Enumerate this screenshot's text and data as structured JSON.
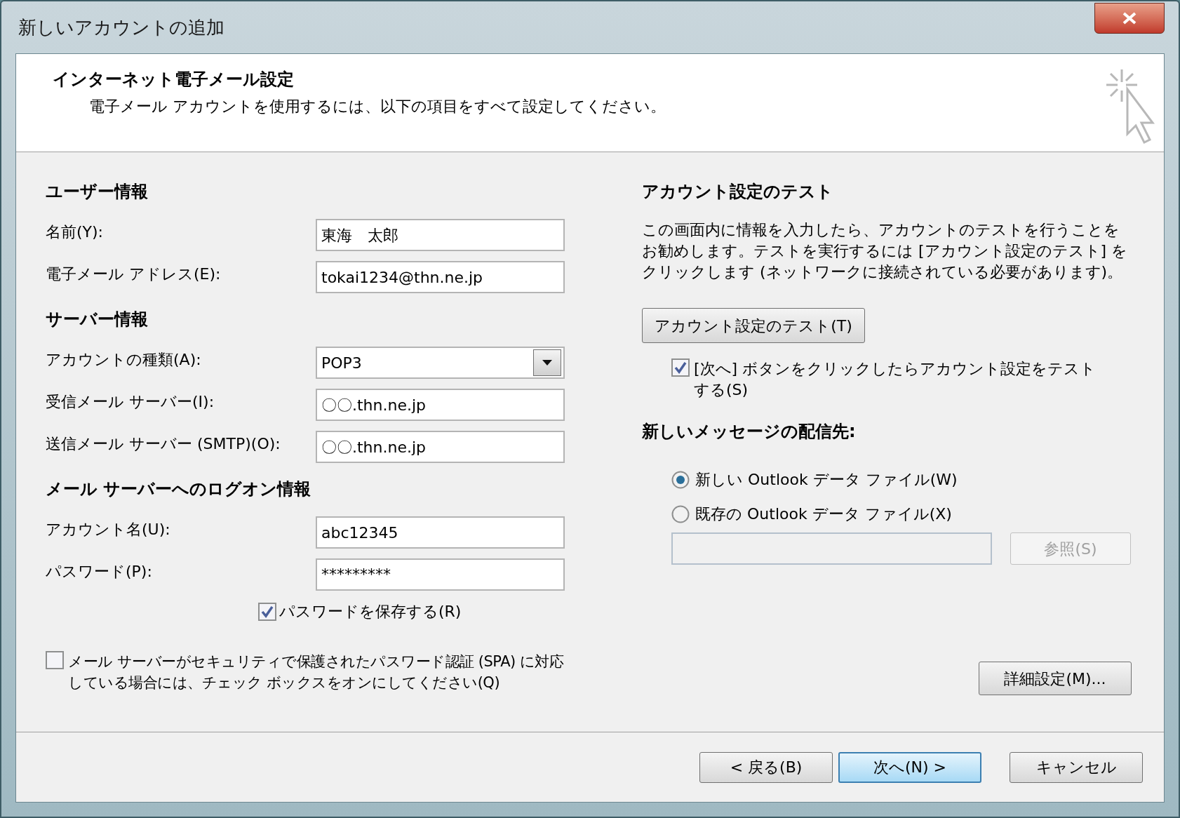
{
  "window": {
    "title": "新しいアカウントの追加"
  },
  "header": {
    "title": "インターネット電子メール設定",
    "subtitle": "電子メール アカウントを使用するには、以下の項目をすべて設定してください。"
  },
  "sections": [
    {
      "heading": "ユーザー情報",
      "fields": [
        {
          "label": "名前(Y):",
          "value": "東海　太郎",
          "kind": "text"
        },
        {
          "label": "電子メール アドレス(E):",
          "value": "tokai1234@thn.ne.jp",
          "kind": "text"
        }
      ]
    },
    {
      "heading": "サーバー情報",
      "fields": [
        {
          "label": "アカウントの種類(A):",
          "value": "POP3",
          "kind": "dropdown"
        },
        {
          "label": "受信メール サーバー(I):",
          "value": "〇〇.thn.ne.jp",
          "kind": "text"
        },
        {
          "label": "送信メール サーバー (SMTP)(O):",
          "value": "〇〇.thn.ne.jp",
          "kind": "text"
        }
      ]
    },
    {
      "heading": "メール サーバーへのログオン情報",
      "fields": [
        {
          "label": "アカウント名(U):",
          "value": "abc12345",
          "kind": "text"
        },
        {
          "label": "パスワード(P):",
          "value": "*********",
          "kind": "password"
        }
      ]
    }
  ],
  "save_password": {
    "label": "パスワードを保存する(R)",
    "checked": true
  },
  "spa": {
    "label": "メール サーバーがセキュリティで保護されたパスワード認証 (SPA) に対応している場合には、チェック ボックスをオンにしてください(Q)",
    "checked": false
  },
  "test": {
    "heading": "アカウント設定のテスト",
    "description": "この画面内に情報を入力したら、アカウントのテストを行うことをお勧めします。テストを実行するには [アカウント設定のテスト] をクリックします (ネットワークに接続されている必要があります)。",
    "button": "アカウント設定のテスト(T)",
    "checkbox": {
      "label": "[次へ] ボタンをクリックしたらアカウント設定をテストする(S)",
      "checked": true
    }
  },
  "delivery": {
    "heading": "新しいメッセージの配信先:",
    "options": [
      {
        "label": "新しい Outlook データ ファイル(W)",
        "selected": true
      },
      {
        "label": "既存の Outlook データ ファイル(X)",
        "selected": false
      }
    ],
    "path_disabled": true,
    "browse": {
      "label": "参照(S)",
      "disabled": true
    }
  },
  "advanced_button": "詳細設定(M)...",
  "footer_buttons": [
    {
      "label": "< 戻る(B)",
      "default": false
    },
    {
      "label": "次へ(N) >",
      "default": true
    },
    {
      "label": "キャンセル",
      "default": false
    }
  ]
}
